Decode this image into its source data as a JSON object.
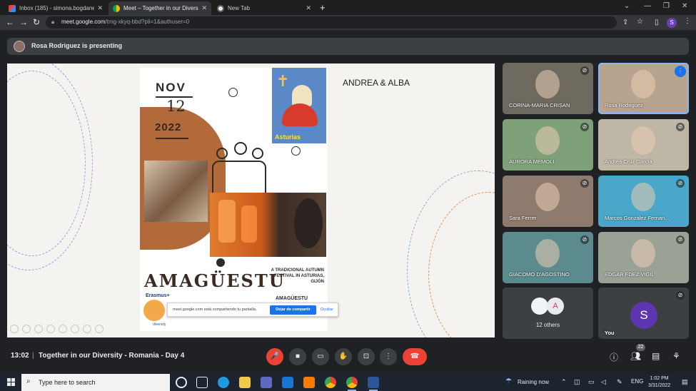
{
  "browser": {
    "tabs": [
      {
        "title": "Inbox (185) - simona.bogdanesc...",
        "icon": "gmail-icon",
        "active": false
      },
      {
        "title": "Meet – Together in our Diversi...",
        "icon": "meet-icon",
        "active": true
      },
      {
        "title": "New Tab",
        "icon": "chrome-icon",
        "active": false
      }
    ],
    "url_host": "meet.google.com",
    "url_path": "/tmg-xkyq-bbd?pli=1&authuser=0",
    "profile_initial": "S"
  },
  "presenting": {
    "text": "Rosa Rodriguez is presenting"
  },
  "shared_screen": {
    "heading": "ANDREA & ALBA",
    "slide": {
      "month": "NOV",
      "day": "12",
      "year": "2022",
      "poster_label": "Asturias",
      "title": "AMAGÜESTU",
      "subtitle": "A TRADICIONAL AUTUMN FESTIVAL IN ASTURIAS, GIJÓN",
      "subtitle2": "AMAGÜESTU",
      "erasmus": "Erasmus+",
      "diversity": "diversity"
    },
    "share_notice": {
      "text": "meet.google.com está compartiendo tu pantalla.",
      "stop_label": "Dejar de compartir",
      "hide_label": "Ocultar"
    }
  },
  "participants": [
    {
      "name": "CORINA-MARIA CRIȘAN",
      "muted": true,
      "speaking": false,
      "bg": "#6e6a60"
    },
    {
      "name": "Rosa Rodriguez",
      "muted": false,
      "speaking": true,
      "bg": "#b7a48e"
    },
    {
      "name": "AURORA MEMOLI",
      "muted": true,
      "speaking": false,
      "bg": "#7ea17a"
    },
    {
      "name": "Andrea Cruz García",
      "muted": true,
      "speaking": false,
      "bg": "#bfb7a5"
    },
    {
      "name": "Sara Ferrer",
      "muted": true,
      "speaking": false,
      "bg": "#8f7b6d"
    },
    {
      "name": "Marcos Gonzalez Fernan...",
      "muted": true,
      "speaking": false,
      "bg": "#4aa7c9"
    },
    {
      "name": "GIACOMO D'AGOSTINO",
      "muted": true,
      "speaking": false,
      "bg": "#5b8a8f"
    },
    {
      "name": "EDGAR FDEZ VIGIL",
      "muted": true,
      "speaking": false,
      "bg": "#9aa296"
    }
  ],
  "others": {
    "label": "12 others",
    "avatar_letter": "A"
  },
  "you": {
    "label": "You",
    "avatar_letter": "S"
  },
  "meeting": {
    "time": "13:02",
    "separator": "|",
    "title": "Together in our Diversity - Romania - Day 4",
    "people_count": "22"
  },
  "controls": [
    {
      "name": "microphone-off-button",
      "icon": "mic-off-icon",
      "glyph": "🎤"
    },
    {
      "name": "camera-button",
      "icon": "camera-icon",
      "glyph": "■"
    },
    {
      "name": "captions-button",
      "icon": "captions-icon",
      "glyph": "▭"
    },
    {
      "name": "raise-hand-button",
      "icon": "hand-icon",
      "glyph": "✋"
    },
    {
      "name": "present-button",
      "icon": "present-icon",
      "glyph": "⊡"
    },
    {
      "name": "more-options-button",
      "icon": "more-vert-icon",
      "glyph": "⋮"
    }
  ],
  "taskbar": {
    "search_placeholder": "Type here to search",
    "weather": "Raining now",
    "language": "ENG",
    "time": "1:02 PM",
    "date": "3/31/2022"
  },
  "colors": {
    "end_call": "#ea4335",
    "speaking_outline": "#8ab4f8",
    "accent_blue": "#1a73e8"
  }
}
